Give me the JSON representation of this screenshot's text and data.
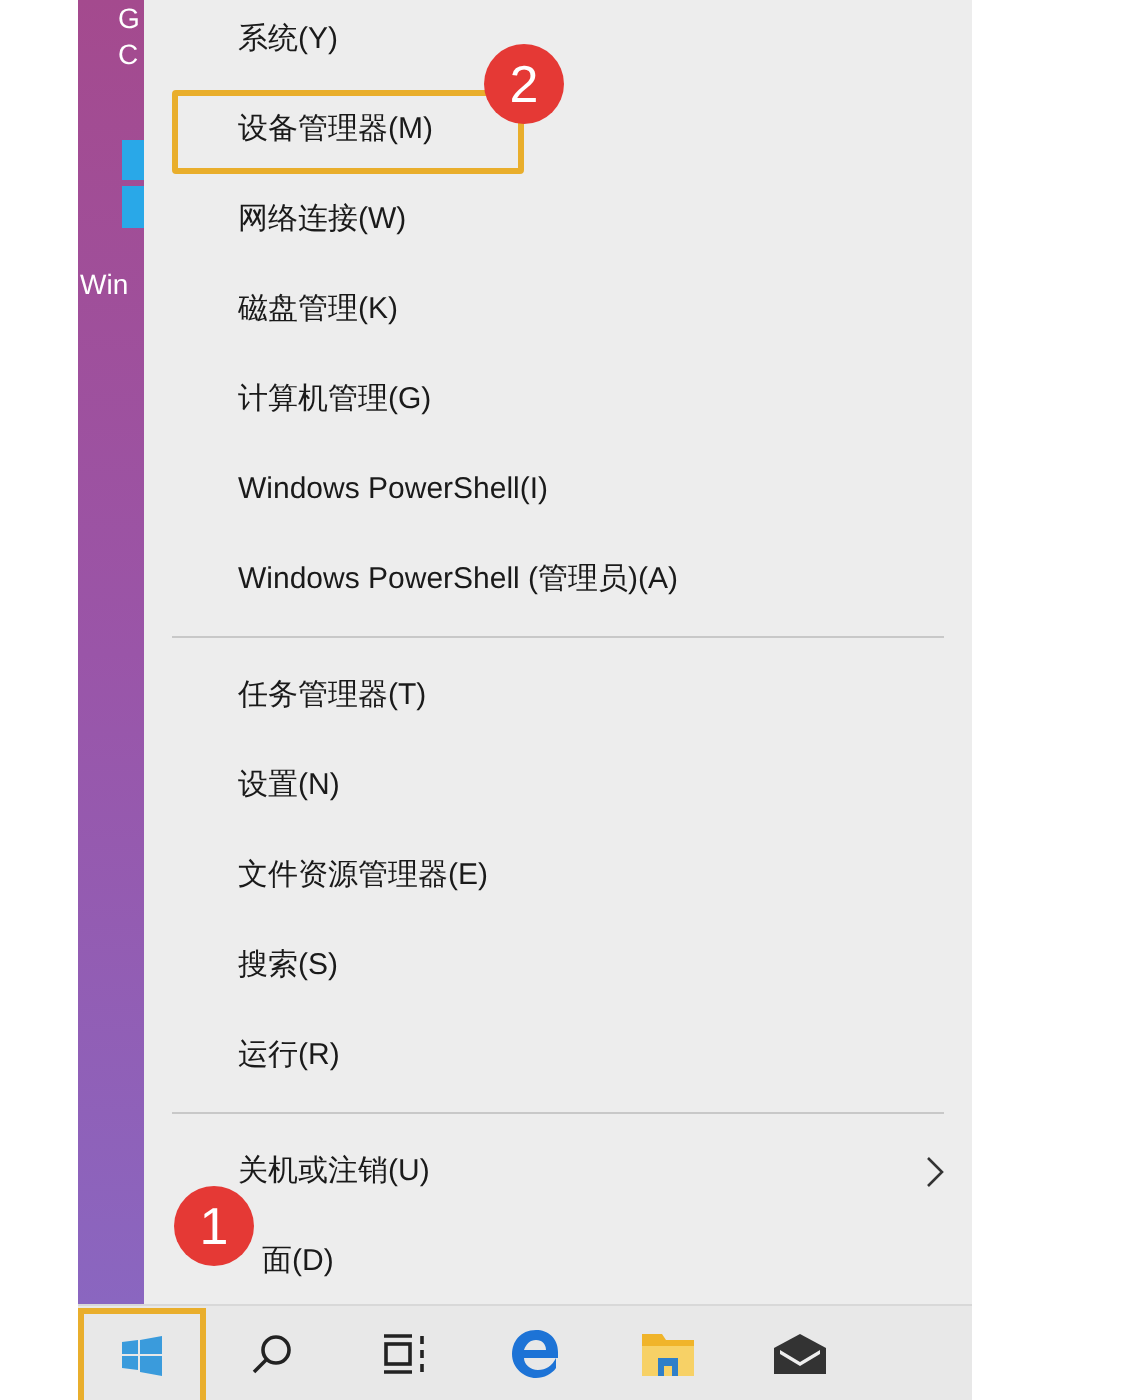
{
  "desktop": {
    "labels": [
      "G",
      "C",
      "Win"
    ]
  },
  "menu": {
    "groups": [
      [
        {
          "label": "系统(Y)",
          "highlighted": false,
          "submenu": false
        },
        {
          "label": "设备管理器(M)",
          "highlighted": true,
          "submenu": false,
          "badge": "2"
        },
        {
          "label": "网络连接(W)",
          "highlighted": false,
          "submenu": false
        },
        {
          "label": "磁盘管理(K)",
          "highlighted": false,
          "submenu": false
        },
        {
          "label": "计算机管理(G)",
          "highlighted": false,
          "submenu": false
        },
        {
          "label": "Windows PowerShell(I)",
          "highlighted": false,
          "submenu": false
        },
        {
          "label": "Windows PowerShell (管理员)(A)",
          "highlighted": false,
          "submenu": false
        }
      ],
      [
        {
          "label": "任务管理器(T)",
          "highlighted": false,
          "submenu": false
        },
        {
          "label": "设置(N)",
          "highlighted": false,
          "submenu": false
        },
        {
          "label": "文件资源管理器(E)",
          "highlighted": false,
          "submenu": false
        },
        {
          "label": "搜索(S)",
          "highlighted": false,
          "submenu": false
        },
        {
          "label": "运行(R)",
          "highlighted": false,
          "submenu": false
        }
      ],
      [
        {
          "label": "关机或注销(U)",
          "highlighted": false,
          "submenu": true
        },
        {
          "label": "面(D)",
          "highlighted": false,
          "submenu": false,
          "badge": "1"
        }
      ]
    ]
  },
  "taskbar": {
    "start_highlighted": true
  }
}
